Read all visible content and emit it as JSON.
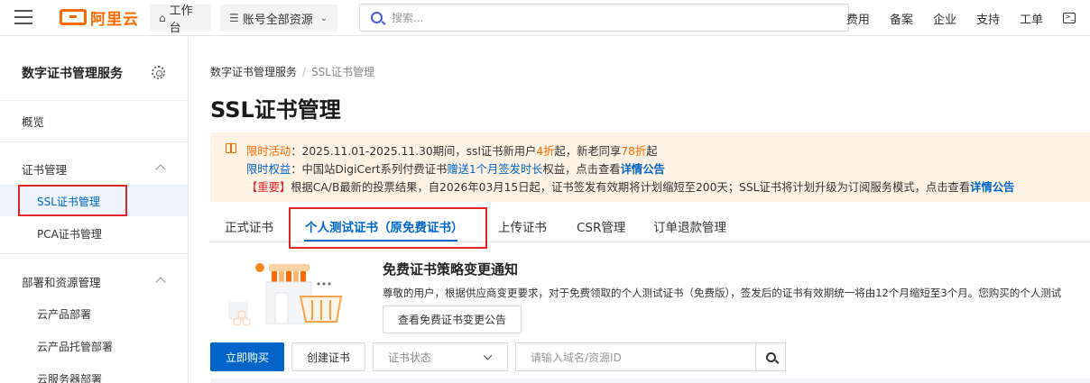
{
  "topbar": {
    "logo_text": "阿里云",
    "workbench": "工作台",
    "account_resources": "账号全部资源",
    "search_placeholder": "搜索...",
    "links": [
      "费用",
      "备案",
      "企业",
      "支持",
      "工单"
    ],
    "brand_color": "#ff6a00"
  },
  "sidebar": {
    "title": "数字证书管理服务",
    "overview": "概览",
    "group_cert": "证书管理",
    "ssl": "SSL证书管理",
    "pca": "PCA证书管理",
    "group_deploy": "部署和资源管理",
    "cloud_deploy": "云产品部署",
    "cloud_hosted": "云产品托管部署",
    "server_deploy": "云服务器部署"
  },
  "main": {
    "breadcrumb": [
      "数字证书管理服务",
      "SSL证书管理"
    ],
    "title": "SSL证书管理",
    "notice": {
      "l1_label": "限时活动",
      "l1_text_a": "：2025.11.01-2025.11.30期间，ssl证书新用户",
      "l1_discount1": "4折",
      "l1_text_b": "起，新老同享",
      "l1_discount2": "78折",
      "l1_text_c": "起",
      "l2_label": "限时权益",
      "l2_text_a": "：中国站DigiCert系列付费证书",
      "l2_highlight": "赠送1个月签发时长",
      "l2_text_b": "权益，点击查看",
      "l2_link": "详情公告",
      "l3_label": "【重要】",
      "l3_text": "根据CA/B最新的投票结果，自2026年03月15日起，证书签发有效期将计划缩短至200天；SSL证书将计划升级为订阅服务模式，点击查看",
      "l3_link": "详情公告"
    },
    "tabs": [
      "正式证书",
      "个人测试证书（原免费证书）",
      "上传证书",
      "CSR管理",
      "订单退款管理"
    ],
    "active_tab": 1,
    "policy": {
      "title": "免费证书策略变更通知",
      "desc": "尊敬的用户，根据供应商变更要求，对于免费领取的个人测试证书（免费版），签发后的证书有效期统一将由12个月缩短至3个月。您购买的个人测试",
      "button": "查看免费证书变更公告"
    },
    "actions": {
      "buy": "立即购买",
      "create": "创建证书",
      "status_placeholder": "证书状态",
      "search_placeholder": "请输入域名/资源ID"
    }
  }
}
